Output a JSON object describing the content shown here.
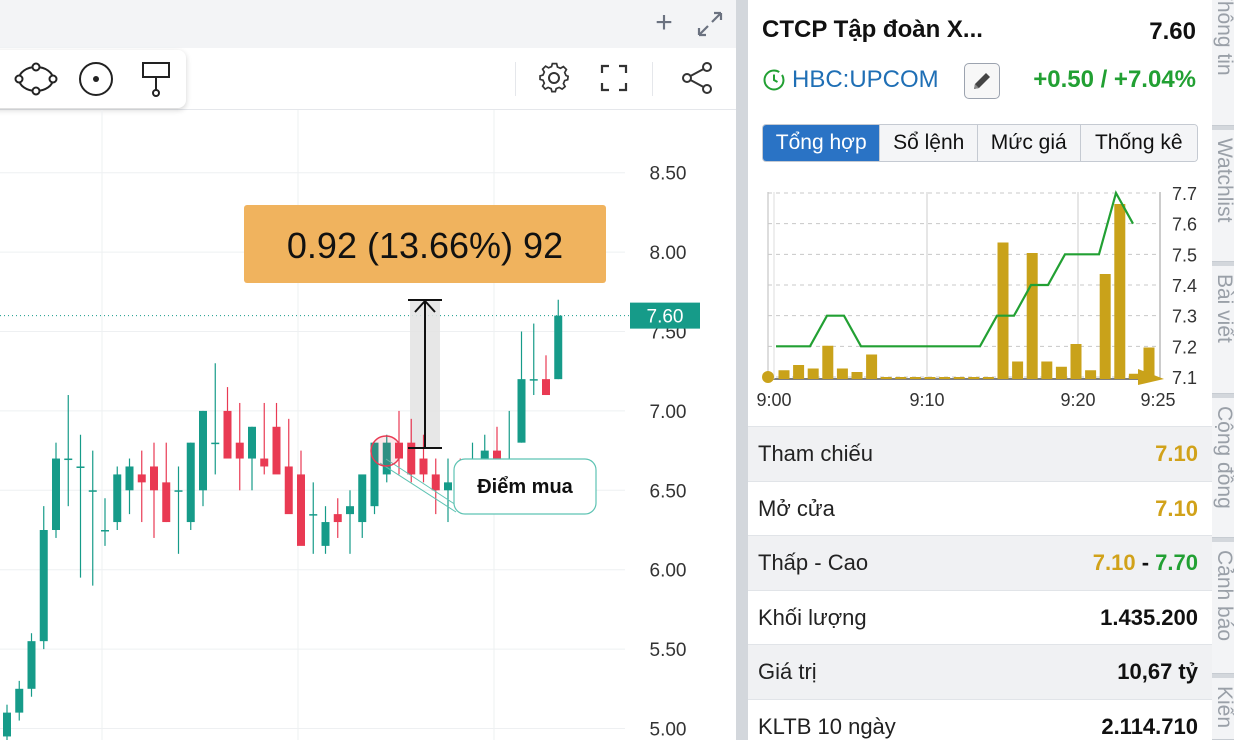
{
  "chart_toolbar": {
    "add_icon": "plus-icon",
    "expand_icon": "expand-arrows-icon",
    "drawing_tools": [
      "ellipse-tool-icon",
      "circle-point-tool-icon",
      "flag-marker-tool-icon"
    ],
    "right_tools": [
      "settings-gear-icon",
      "fullscreen-icon",
      "share-icon"
    ]
  },
  "main_chart": {
    "y_axis_ticks": [
      "8.50",
      "8.00",
      "7.50",
      "7.00",
      "6.50",
      "6.00",
      "5.50",
      "5.00"
    ],
    "current_price_label": "7.60",
    "measure_label": "0.92 (13.66%) 92",
    "buy_point_label": "Điểm mua",
    "colors": {
      "up": "#169b89",
      "down": "#e93a53",
      "price_tag": "#169b89",
      "measure_box": "#f0b35e"
    }
  },
  "chart_data": {
    "type": "candlestick",
    "y_range": [
      5.0,
      8.5
    ],
    "open": [
      4.95,
      5.1,
      5.25,
      5.55,
      6.25,
      6.7,
      6.65,
      6.5,
      6.25,
      6.3,
      6.5,
      6.6,
      6.65,
      6.55,
      6.5,
      6.3,
      6.5,
      6.8,
      7.0,
      6.8,
      6.7,
      6.7,
      6.9,
      6.65,
      6.6,
      6.35,
      6.15,
      6.35,
      6.35,
      6.3,
      6.4,
      6.6,
      6.8,
      6.8,
      6.7,
      6.6,
      6.5,
      6.55,
      6.5,
      6.6,
      6.75,
      6.7,
      6.8,
      7.2,
      7.2,
      7.2
    ],
    "high": [
      5.15,
      5.3,
      5.6,
      6.4,
      6.8,
      7.1,
      6.85,
      6.75,
      6.45,
      6.65,
      6.7,
      6.75,
      6.8,
      6.8,
      6.65,
      6.8,
      7.0,
      7.3,
      7.15,
      7.05,
      6.9,
      7.05,
      7.05,
      6.95,
      6.75,
      6.55,
      6.4,
      6.45,
      6.5,
      6.5,
      6.65,
      6.85,
      7.0,
      6.95,
      6.85,
      6.7,
      6.7,
      6.7,
      6.8,
      6.85,
      6.9,
      7.0,
      7.5,
      7.55,
      7.35,
      7.7
    ],
    "low": [
      4.9,
      5.05,
      5.2,
      5.5,
      6.2,
      6.4,
      5.95,
      5.9,
      6.15,
      6.25,
      6.35,
      6.3,
      6.2,
      6.3,
      6.1,
      6.25,
      6.4,
      6.6,
      6.9,
      6.5,
      6.5,
      6.6,
      6.65,
      6.55,
      6.2,
      6.1,
      6.1,
      6.2,
      6.1,
      6.2,
      6.35,
      6.55,
      6.6,
      6.55,
      6.55,
      6.35,
      6.3,
      6.45,
      6.5,
      6.55,
      6.7,
      6.6,
      6.8,
      7.1,
      7.1,
      7.2
    ],
    "close": [
      5.1,
      5.25,
      5.55,
      6.25,
      6.7,
      6.7,
      6.65,
      6.5,
      6.25,
      6.6,
      6.65,
      6.55,
      6.5,
      6.3,
      6.5,
      6.8,
      7.0,
      6.8,
      6.7,
      6.7,
      6.9,
      6.65,
      6.6,
      6.35,
      6.15,
      6.35,
      6.3,
      6.3,
      6.4,
      6.6,
      6.8,
      6.8,
      6.7,
      6.6,
      6.6,
      6.5,
      6.55,
      6.5,
      6.6,
      6.75,
      6.7,
      6.7,
      7.2,
      7.2,
      7.1,
      7.6
    ]
  },
  "info": {
    "company_name": "CTCP Tập đoàn X...",
    "last_price": "7.60",
    "ticker": "HBC:UPCOM",
    "change": "+0.50 / +7.04%",
    "tabs": [
      "Tổng hợp",
      "Sổ lệnh",
      "Mức giá",
      "Thống kê"
    ],
    "active_tab": 0,
    "stats": [
      {
        "label": "Tham chiếu",
        "value": "7.10"
      },
      {
        "label": "Mở cửa",
        "value": "7.10"
      },
      {
        "label": "Thấp - Cao",
        "low": "7.10",
        "separator": "-",
        "high": "7.70"
      },
      {
        "label": "Khối lượng",
        "value": "1.435.200"
      },
      {
        "label": "Giá trị",
        "value": "10,67 tỷ"
      },
      {
        "label": "KLTB 10 ngày",
        "value": "2.114.710"
      }
    ],
    "colors": {
      "up": "#22a033",
      "ref": "#d1a21a",
      "ticker": "#1f6fb5",
      "active_tab": "#2a73c5"
    }
  },
  "intraday_chart": {
    "type": "line-with-volume-bars",
    "y_ticks": [
      "7.7",
      "7.6",
      "7.5",
      "7.4",
      "7.3",
      "7.2",
      "7.1"
    ],
    "x_ticks": [
      "9:00",
      "9:10",
      "9:20",
      "9:25"
    ],
    "price_line": [
      7.2,
      7.2,
      7.2,
      7.3,
      7.3,
      7.2,
      7.2,
      7.2,
      7.2,
      7.2,
      7.2,
      7.2,
      7.2,
      7.3,
      7.3,
      7.4,
      7.4,
      7.5,
      7.5,
      7.5,
      7.7,
      7.6
    ],
    "volume_bars": [
      0.05,
      0.08,
      0.06,
      0.19,
      0.06,
      0.04,
      0.14,
      0.01,
      0.01,
      0.01,
      0.01,
      0.01,
      0.01,
      0.01,
      0.01,
      0.78,
      0.1,
      0.72,
      0.1,
      0.07,
      0.2,
      0.05,
      0.6,
      1.0,
      0.03,
      0.18
    ],
    "colors": {
      "line": "#22a033",
      "bar": "#c9a21a",
      "reference_marker": "#c9a21a"
    }
  },
  "side_tabs": [
    "Thông tin",
    "Watchlist",
    "Bài viết",
    "Cộng đồng",
    "Cảnh báo",
    "Kiến"
  ]
}
